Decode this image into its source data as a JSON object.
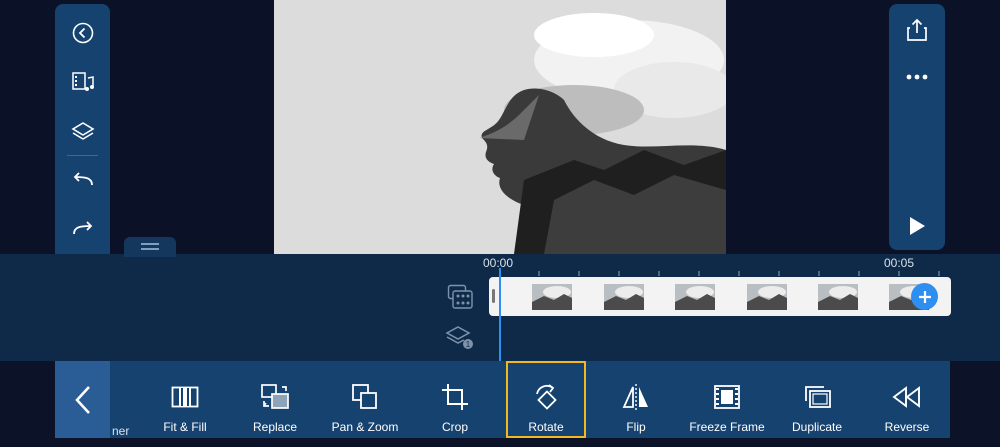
{
  "colors": {
    "background": "#0c1329",
    "panel": "#15426e",
    "accent": "#2f8ff0",
    "selection": "#f2b820"
  },
  "left_rail": {
    "items": [
      {
        "name": "back-circle-icon"
      },
      {
        "name": "media-music-icon"
      },
      {
        "name": "layers-icon"
      },
      {
        "name": "undo-icon"
      },
      {
        "name": "redo-icon"
      },
      {
        "name": "trash-icon"
      }
    ]
  },
  "right_rail": {
    "items": [
      {
        "name": "share-icon"
      },
      {
        "name": "more-icon"
      },
      {
        "name": "play-icon"
      }
    ]
  },
  "timeline": {
    "start_time": "00:00",
    "end_time": "00:05",
    "clip_thumbnail_count": 6
  },
  "toolbar": {
    "partial_label": "ner",
    "tools": [
      {
        "label": "Fit & Fill",
        "icon": "fit-fill-icon"
      },
      {
        "label": "Replace",
        "icon": "replace-icon"
      },
      {
        "label": "Pan & Zoom",
        "icon": "pan-zoom-icon"
      },
      {
        "label": "Crop",
        "icon": "crop-icon"
      },
      {
        "label": "Rotate",
        "icon": "rotate-icon",
        "selected": true
      },
      {
        "label": "Flip",
        "icon": "flip-icon"
      },
      {
        "label": "Freeze Frame",
        "icon": "freeze-frame-icon"
      },
      {
        "label": "Duplicate",
        "icon": "duplicate-icon"
      },
      {
        "label": "Reverse",
        "icon": "reverse-icon"
      }
    ]
  }
}
